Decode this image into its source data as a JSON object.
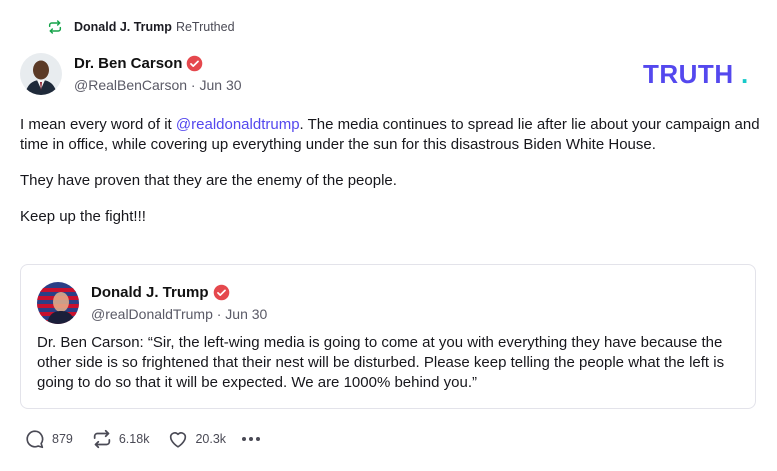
{
  "retruth": {
    "user": "Donald J. Trump",
    "label": "ReTruthed"
  },
  "post": {
    "author": "Dr. Ben Carson",
    "handle": "@RealBenCarson · Jun 30",
    "paragraph1_prefix": "I mean every word of it ",
    "mention": "@realdonaldtrump",
    "paragraph1_suffix": ". The media continues to spread lie after lie about your campaign and time in office, while covering up everything under the sun for this disastrous Biden White House.",
    "paragraph2": "They have proven that they are the enemy of the people.",
    "paragraph3": "Keep up the fight!!!"
  },
  "quote": {
    "author": "Donald J. Trump",
    "handle": "@realDonaldTrump · Jun 30",
    "text": "Dr. Ben Carson: “Sir, the left-wing media is going to come at you with everything they have because the other side is so frightened that their nest will be disturbed. Please keep telling the people what the left is going to do so that it will be expected. We are 1000% behind you.”"
  },
  "logo": {
    "text": "TRUTH",
    "dot": ".",
    "color": "#5448ee",
    "dot_color": "#17c9c9"
  },
  "actions": {
    "replies": "879",
    "retruths": "6.18k",
    "likes": "20.3k"
  },
  "icons": [
    "retruth-icon",
    "verified-badge-icon",
    "reply-icon",
    "retruth-action-icon",
    "like-icon",
    "more-icon"
  ]
}
